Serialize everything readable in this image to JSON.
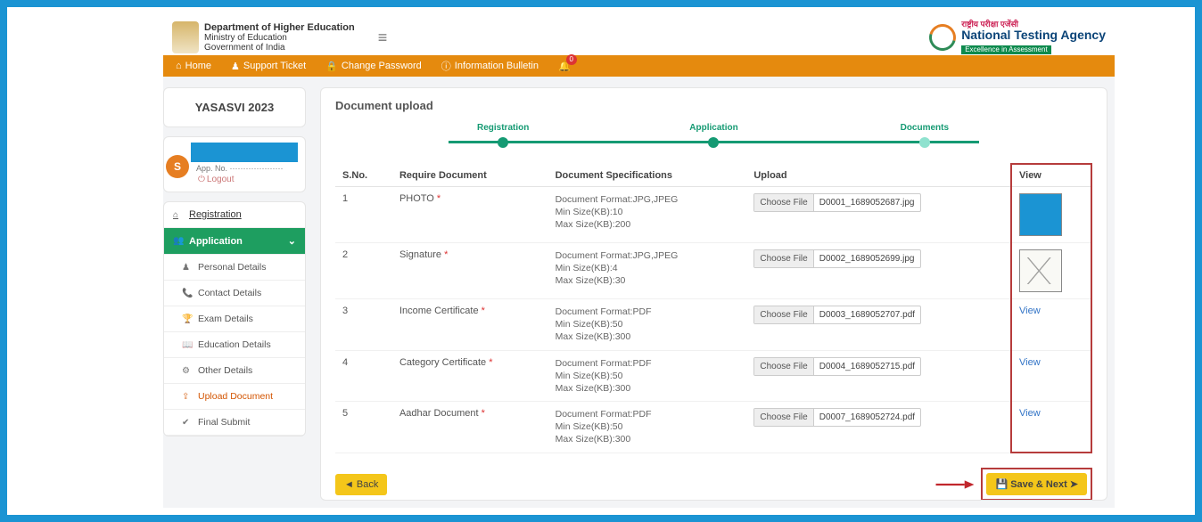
{
  "gov": {
    "l1": "Department of Higher Education",
    "l2": "Ministry of Education",
    "l3": "Government of India"
  },
  "nta": {
    "hindi": "राष्ट्रीय परीक्षा एजेंसी",
    "eng": "National Testing Agency",
    "tag": "Excellence in Assessment"
  },
  "nav": {
    "home": "Home",
    "ticket": "Support Ticket",
    "pwd": "Change Password",
    "bulletin": "Information Bulletin",
    "badge": "0"
  },
  "year_card": "YASASVI 2023",
  "user": {
    "initial": "S",
    "line2": "App. No. ····················",
    "logout": "Logout"
  },
  "side": {
    "registration": "Registration",
    "application": "Application",
    "personal": "Personal Details",
    "contact": "Contact Details",
    "exam": "Exam Details",
    "education": "Education Details",
    "other": "Other Details",
    "upload": "Upload Document",
    "final": "Final Submit"
  },
  "panel": {
    "title": "Document upload"
  },
  "steps": {
    "s1": "Registration",
    "s2": "Application",
    "s3": "Documents"
  },
  "headers": {
    "sno": "S.No.",
    "req": "Require Document",
    "spec": "Document Specifications",
    "upload": "Upload",
    "view": "View"
  },
  "choose_label": "Choose File",
  "view_label": "View",
  "rows": [
    {
      "sno": "1",
      "req": "PHOTO",
      "spec_l1": "Document Format:JPG,JPEG",
      "spec_l2": "Min Size(KB):10",
      "spec_l3": "Max Size(KB):200",
      "file": "D0001_1689052687.jpg",
      "viewtype": "photo"
    },
    {
      "sno": "2",
      "req": "Signature",
      "spec_l1": "Document Format:JPG,JPEG",
      "spec_l2": "Min Size(KB):4",
      "spec_l3": "Max Size(KB):30",
      "file": "D0002_1689052699.jpg",
      "viewtype": "sig"
    },
    {
      "sno": "3",
      "req": "Income Certificate",
      "spec_l1": "Document Format:PDF",
      "spec_l2": "Min Size(KB):50",
      "spec_l3": "Max Size(KB):300",
      "file": "D0003_1689052707.pdf",
      "viewtype": "link"
    },
    {
      "sno": "4",
      "req": "Category Certificate",
      "spec_l1": "Document Format:PDF",
      "spec_l2": "Min Size(KB):50",
      "spec_l3": "Max Size(KB):300",
      "file": "D0004_1689052715.pdf",
      "viewtype": "link"
    },
    {
      "sno": "5",
      "req": "Aadhar Document",
      "spec_l1": "Document Format:PDF",
      "spec_l2": "Min Size(KB):50",
      "spec_l3": "Max Size(KB):300",
      "file": "D0007_1689052724.pdf",
      "viewtype": "link"
    }
  ],
  "actions": {
    "back": "Back",
    "save": "Save & Next"
  }
}
